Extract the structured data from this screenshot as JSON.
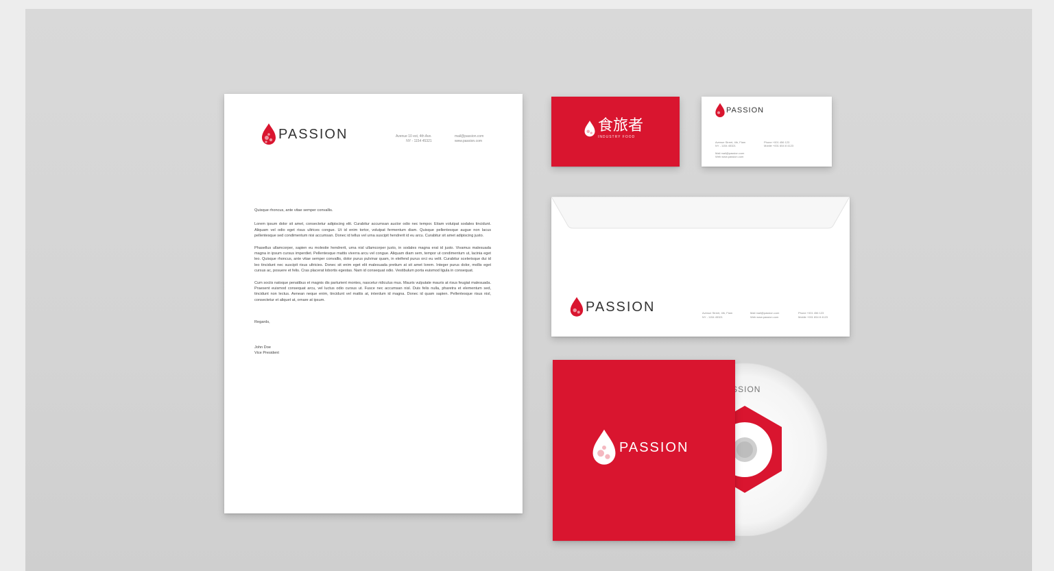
{
  "brand": {
    "name": "PASSION",
    "chinese_name": "食旅者",
    "chinese_sub": "INDUSTRY  FOOD",
    "red": "#d9152f"
  },
  "letterhead": {
    "address_1": "Avenue 10 est, 4th Ave.",
    "address_2": "NY - 1154 45321",
    "web_1": "mail@passion.com",
    "web_2": "www.passion.com",
    "salutation": "Quisque rhoncus, ante vitae semper convallis.",
    "p1": "Lorem ipsum dolor sit amet, consectetur adipiscing elit. Curabitur accumsan auctor odio nec tempor. Etiam volutpat sodales tincidunt. Aliquam vel odio eget risus ultrices congue. Ut id enim tortor, volutpat fermentum diam. Quisque pellentesque augue non lacus pellentesque sed condimentum nisi accumsan. Donec id tellus vel urna suscipit hendrerit id eu arcu. Curabitur sit amet adipiscing justo.",
    "p2": "Phasellus ullamcorper, sapien eu molestie hendrerit, urna nisl ullamcorper justo, in sodales magna erat id justo. Vivamus malesuada magna in ipsum cursus imperdiet. Pellentesque mattis viverra arcu vel congue. Aliquam diam sem, tempor ut condimentum ut, lacinia eget leo. Quisque rhoncus, ante vitae semper convallis, dolor purus pulvinar quam, in eleifend purus orci eu velit. Curabitur scelerisque dui id leo tincidunt nec suscipit risus ultricies. Donec sit enim eget elit malesuada pretium at sit amet lorem. Integer purus dolor, mollis eget cursus ac, posuere et felis. Cras placerat lobortis egestas. Nam id consequat odio. Vestibulum porta euismod ligula in consequat.",
    "p3": "Cum sociis natoque penatibus et magnis dis parturient montes, nascetur ridiculus mus. Mauris vulputate mauris at risus feugiat malesuada. Praesent euismod consequat arcu, vel luctus odio cursus ut. Fusce nec accumsan nisl. Duis felis nulla, pharetra et elementum sed, tincidunt non lectus. Aenean neque enim, tincidunt vel mattis at, interdum id magna. Donec id quam sapien. Pellentesque risus nisl, consectetur et aliquet at, ornare at ipsum.",
    "closing": "Regards,",
    "signer_name": "John Doe",
    "signer_title": "Vice President"
  },
  "card_white": {
    "line_1": "Avenue Street, 4th, Flam",
    "line_2": "NY - 1154 45321",
    "line_3": "Mail mail@passion.com",
    "line_4": "Web www.passion.com",
    "line_5": "Phone +001 456 123",
    "line_6": "Mobile +001 654 8 4123"
  },
  "envelope": {
    "col1_a": "Avenue Street, 4th, Flam",
    "col1_b": "NY - 1154 45321",
    "col2_a": "Mail mail@passion.com",
    "col2_b": "Web www.passion.com",
    "col3_a": "Phone +001 456 123",
    "col3_b": "Mobile +001 654 8 4123"
  },
  "cd": {
    "label": "PASSION"
  }
}
